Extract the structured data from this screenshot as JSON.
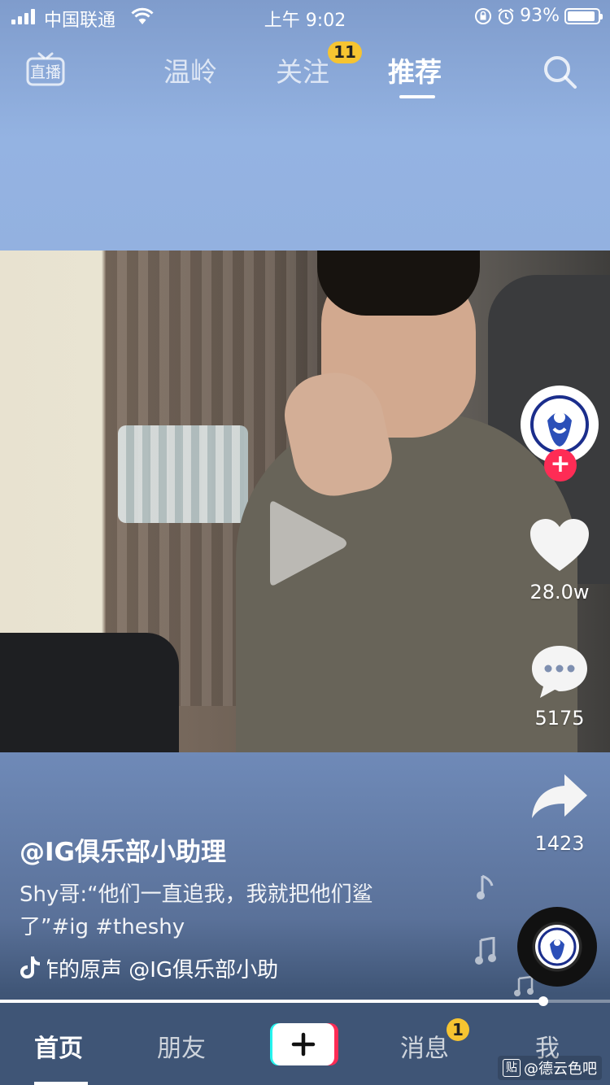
{
  "status_bar": {
    "carrier": "中国联通",
    "time": "上午 9:02",
    "battery": "93%",
    "battery_level": 0.93
  },
  "top_nav": {
    "live_label": "直播",
    "tabs": [
      {
        "label": "温岭"
      },
      {
        "label": "关注",
        "badge": "11"
      },
      {
        "label": "推荐"
      }
    ],
    "active_tab": "推荐"
  },
  "video": {
    "likes": "28.0w",
    "comments": "5175",
    "shares": "1423",
    "progress": 0.89
  },
  "post": {
    "username": "@IG俱乐部小助理",
    "caption": "Shy哥:“他们一直追我，我就把他们鲨了”#ig #theshy",
    "music": "作的原声    @IG俱乐部小助"
  },
  "bottom_nav": {
    "items": [
      {
        "label": "首页"
      },
      {
        "label": "朋友"
      },
      {
        "label": "消息",
        "badge": "1"
      },
      {
        "label": "我"
      }
    ],
    "active": "首页"
  },
  "watermark": {
    "icon_text": "贴",
    "text": "@德云色吧"
  },
  "colors": {
    "accent_red": "#fe2c55",
    "badge_yellow": "#f6c431",
    "tiktok_cyan": "#25f4ee"
  }
}
